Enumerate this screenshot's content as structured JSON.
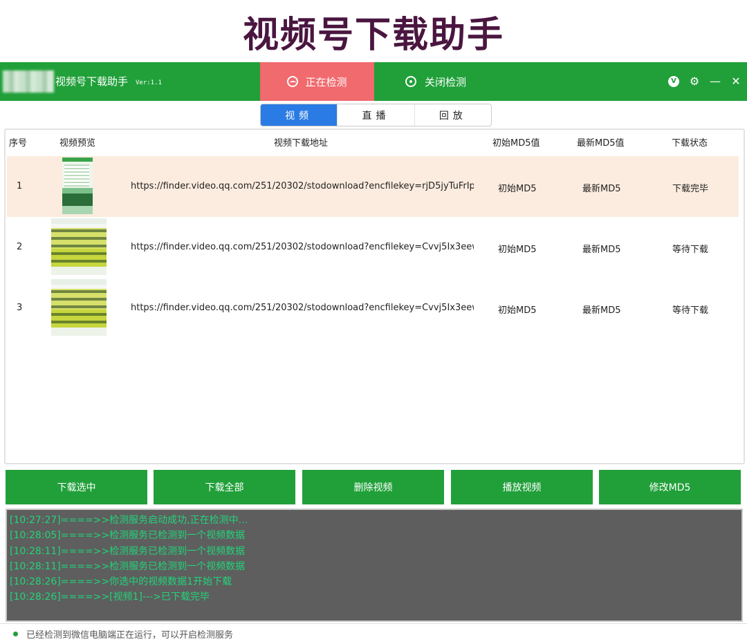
{
  "banner": {
    "title": "视频号下载助手"
  },
  "titlebar": {
    "app_name": "视频号下载助手",
    "version": "Ver:1.1",
    "tab_detecting": "正在检测",
    "tab_stop": "关闭检测",
    "controls": [
      "v-icon",
      "gear-icon",
      "minimize-icon",
      "close-icon"
    ]
  },
  "segments": {
    "video": "视频",
    "live": "直播",
    "replay": "回放",
    "active": "video"
  },
  "table": {
    "headers": {
      "index": "序号",
      "preview": "视频预览",
      "url": "视频下载地址",
      "md5_initial": "初始MD5值",
      "md5_latest": "最新MD5值",
      "status": "下载状态"
    },
    "rows": [
      {
        "index": "1",
        "url": "https://finder.video.qq.com/251/20302/stodownload?encfilekey=rjD5jyTuFrIp",
        "md5_initial": "初始MD5",
        "md5_latest": "最新MD5",
        "status": "下载完毕",
        "selected": true
      },
      {
        "index": "2",
        "url": "https://finder.video.qq.com/251/20302/stodownload?encfilekey=Cvvj5Ix3eew",
        "md5_initial": "初始MD5",
        "md5_latest": "最新MD5",
        "status": "等待下载",
        "selected": false
      },
      {
        "index": "3",
        "url": "https://finder.video.qq.com/251/20302/stodownload?encfilekey=Cvvj5Ix3eew",
        "md5_initial": "初始MD5",
        "md5_latest": "最新MD5",
        "status": "等待下载",
        "selected": false
      }
    ]
  },
  "buttons": {
    "download_selected": "下载选中",
    "download_all": "下载全部",
    "delete_video": "删除视频",
    "play_video": "播放视频",
    "modify_md5": "修改MD5"
  },
  "log": {
    "lines": [
      "[10:27:27]====>>检测服务启动成功,正在检测中...",
      "[10:28:05]====>>检测服务已检测到一个视频数据",
      "[10:28:11]====>>检测服务已检测到一个视频数据",
      "[10:28:11]====>>检测服务已检测到一个视频数据",
      "[10:28:26]====>>你选中的视频数据1开始下载",
      "[10:28:26]====>>[视频1]--->已下载完毕"
    ]
  },
  "statusbar": {
    "text": "已经检测到微信电脑端正在运行，可以开启检测服务"
  },
  "colors": {
    "brand_green": "#21a03a",
    "active_tab": "#f06a6e",
    "segment_active": "#2a7be4",
    "selected_row": "#fcecdf",
    "log_text": "#22d47a",
    "log_bg": "#5e5e5e"
  }
}
